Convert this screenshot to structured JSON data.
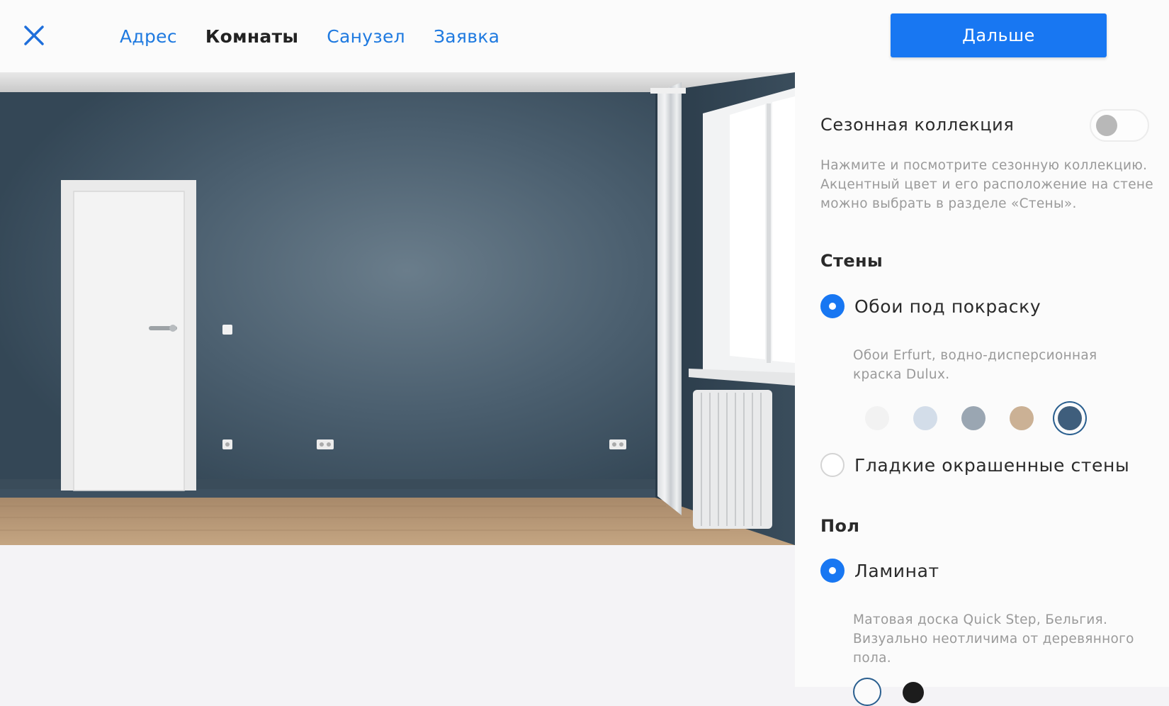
{
  "header": {
    "nav": [
      {
        "label": "Адрес",
        "active": false
      },
      {
        "label": "Комнаты",
        "active": true
      },
      {
        "label": "Санузел",
        "active": false
      },
      {
        "label": "Заявка",
        "active": false
      }
    ],
    "next_label": "Дальше"
  },
  "panel": {
    "seasonal": {
      "title": "Сезонная коллекция",
      "enabled": false,
      "description_lines": [
        "Нажмите и посмотрите сезонную коллекцию.",
        "Акцентный цвет и его расположение на стене",
        "можно выбрать в разделе «Стены»."
      ]
    },
    "walls": {
      "title": "Стены",
      "options": [
        {
          "label": "Обои под покраску",
          "checked": true,
          "description_lines": [
            "Обои Erfurt, водно-дисперсионная",
            "краска Dulux."
          ]
        },
        {
          "label": "Гладкие окрашенные стены",
          "checked": false
        }
      ],
      "swatches": [
        "#f2f2f2",
        "#d3dde9",
        "#9aa6b2",
        "#cbb195",
        "#3f5e7c"
      ],
      "selected_swatch": 4
    },
    "floor": {
      "title": "Пол",
      "options": [
        {
          "label": "Ламинат",
          "checked": true,
          "description_lines": [
            "Матовая доска Quick Step, Бельгия.",
            "Визуально неотличима от деревянного",
            "пола."
          ]
        }
      ]
    }
  },
  "colors": {
    "accent": "#1877f2",
    "link": "#1f7ae0",
    "wall": "#3d5060"
  },
  "icons": {
    "close": "close-icon"
  }
}
